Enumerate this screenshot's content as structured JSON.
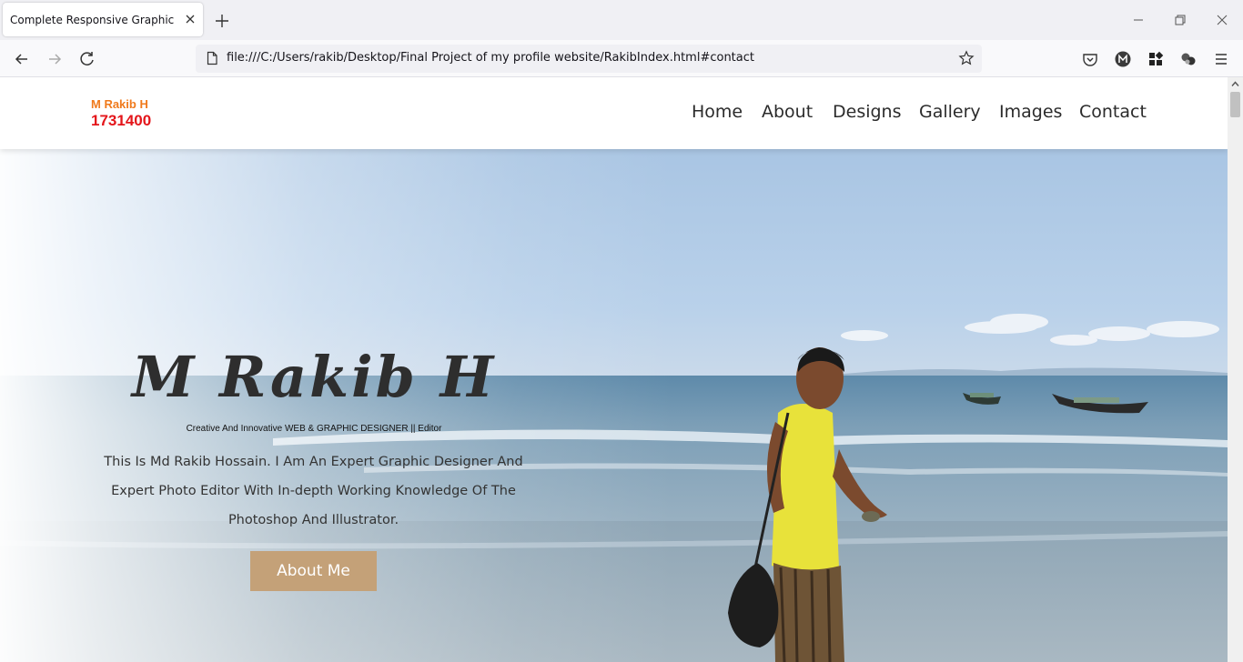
{
  "browser": {
    "tab_title": "Complete Responsive Graphic and",
    "url": "file:///C:/Users/rakib/Desktop/Final Project of my profile website/RakibIndex.html#contact"
  },
  "site": {
    "logo_name": "M Rakib H",
    "logo_id": "1731400",
    "nav": [
      "Home",
      "About",
      "Designs",
      "Gallery",
      "Images",
      "Contact"
    ],
    "colors": {
      "logo_name": "#f07a1c",
      "logo_id": "#e4161b",
      "button": "#c4a178"
    }
  },
  "hero": {
    "title": "M Rakib H",
    "subtitle": "Creative And Innovative WEB & GRAPHIC DESIGNER || Editor",
    "description": "This Is Md Rakib Hossain. I Am An Expert Graphic Designer And Expert Photo Editor With In-depth Working Knowledge Of The Photoshop And Illustrator.",
    "button_label": "About Me"
  }
}
